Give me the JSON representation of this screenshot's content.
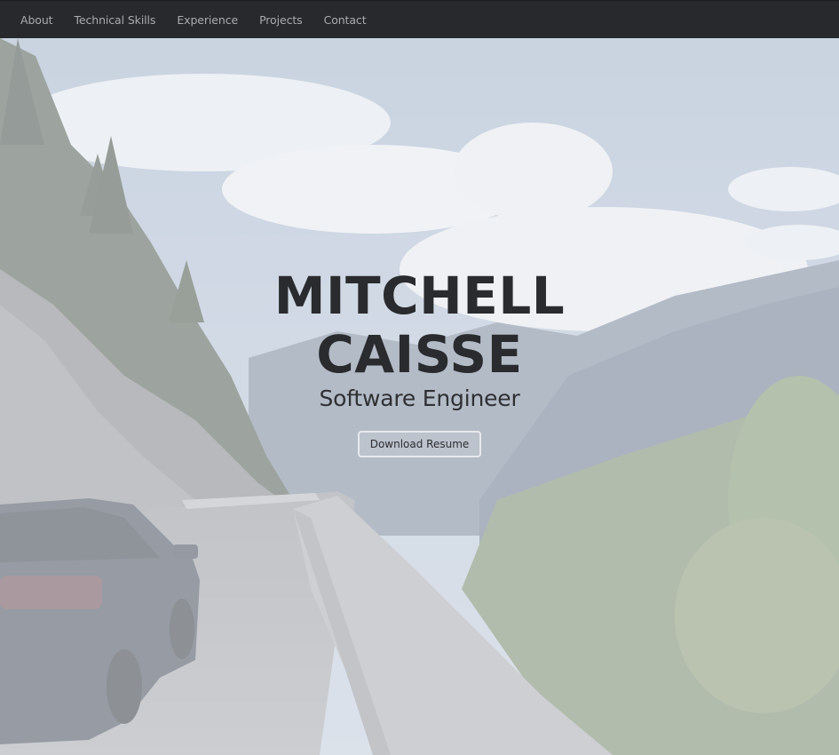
{
  "nav": {
    "items": [
      {
        "label": "About"
      },
      {
        "label": "Technical Skills"
      },
      {
        "label": "Experience"
      },
      {
        "label": "Projects"
      },
      {
        "label": "Contact"
      }
    ]
  },
  "hero": {
    "first_name": "MITCHELL",
    "last_name": "CAISSE",
    "title": "Software Engineer",
    "resume_button": "Download Resume"
  },
  "colors": {
    "navbar_bg": "#27292c",
    "nav_text": "#a9abae",
    "heading_text": "#2a2b2e"
  }
}
